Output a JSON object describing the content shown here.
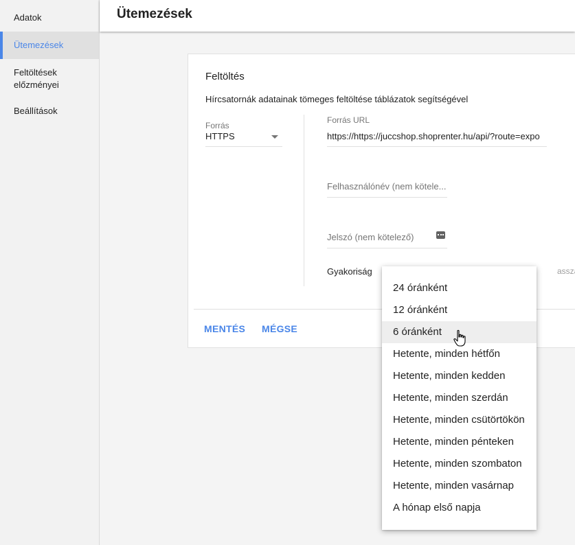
{
  "sidebar": {
    "items": [
      {
        "label": "Adatok"
      },
      {
        "label": "Ütemezések"
      },
      {
        "label": "Feltöltések előzményei"
      },
      {
        "label": "Beállítások"
      }
    ]
  },
  "header": {
    "title": "Ütemezések"
  },
  "card": {
    "section_title": "Feltöltés",
    "description": "Hírcsatornák adatainak tömeges feltöltése táblázatok segítségével",
    "source": {
      "label": "Forrás",
      "value": "HTTPS"
    },
    "url": {
      "label": "Forrás URL",
      "value": "https://https://juccshop.shoprenter.hu/api/?route=expo"
    },
    "username": {
      "placeholder": "Felhasználónév (nem kötele..."
    },
    "password": {
      "placeholder": "Jelszó (nem kötelező)",
      "icon": "password-visibility-icon"
    },
    "frequency": {
      "label": "Gyakoriság",
      "hint": "assza ki, h"
    },
    "buttons": {
      "save": "MENTÉS",
      "cancel": "MÉGSE"
    }
  },
  "dropdown": {
    "options": [
      "24 óránként",
      "12 óránként",
      "6 óránként",
      "Hetente, minden hétfőn",
      "Hetente, minden kedden",
      "Hetente, minden szerdán",
      "Hetente, minden csütörtökön",
      "Hetente, minden pénteken",
      "Hetente, minden szombaton",
      "Hetente, minden vasárnap",
      "A hónap első napja"
    ],
    "hovered": "6 óránként"
  },
  "colors": {
    "accent": "#4a86e8",
    "sidebar_bg": "#f2f2f2",
    "active_bg": "#e0e0e0"
  }
}
